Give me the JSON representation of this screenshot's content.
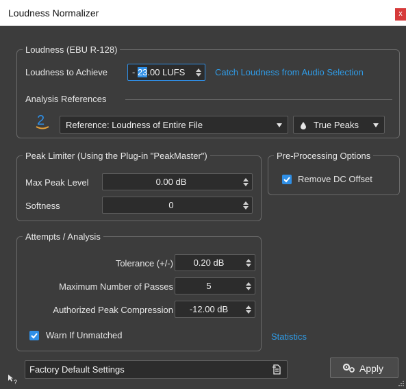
{
  "window": {
    "title": "Loudness Normalizer",
    "close_glyph": "x"
  },
  "loudness": {
    "legend": "Loudness (EBU R-128)",
    "achieve_label": "Loudness to Achieve",
    "value_prefix": "- ",
    "value_selected": "23",
    "value_suffix": ".00 LUFS",
    "catch_link": "Catch Loudness from Audio Selection",
    "analysis_refs_label": "Analysis References",
    "reference_option": "Reference: Loudness of Entire File",
    "true_peaks_label": "True Peaks"
  },
  "limiter": {
    "legend": "Peak Limiter (Using the Plug-in \"PeakMaster\")",
    "max_peak_label": "Max Peak Level",
    "max_peak_value": "0.00 dB",
    "softness_label": "Softness",
    "softness_value": "0"
  },
  "preprocessing": {
    "legend": "Pre-Processing Options",
    "remove_dc_label": "Remove DC Offset",
    "remove_dc_checked": true
  },
  "attempts": {
    "legend": "Attempts / Analysis",
    "tolerance_label": "Tolerance (+/-)",
    "tolerance_value": "0.20 dB",
    "max_passes_label": "Maximum Number of Passes",
    "max_passes_value": "5",
    "peak_comp_label": "Authorized Peak Compression",
    "peak_comp_value": "-12.00 dB",
    "warn_label": "Warn If Unmatched",
    "warn_checked": true
  },
  "statistics_link": "Statistics",
  "footer": {
    "preset_label": "Factory Default Settings",
    "apply_label": "Apply"
  },
  "colors": {
    "accent": "#2f8fe6",
    "link": "#2f9be6",
    "close": "#d63a3a",
    "background": "#3c3c3c"
  }
}
